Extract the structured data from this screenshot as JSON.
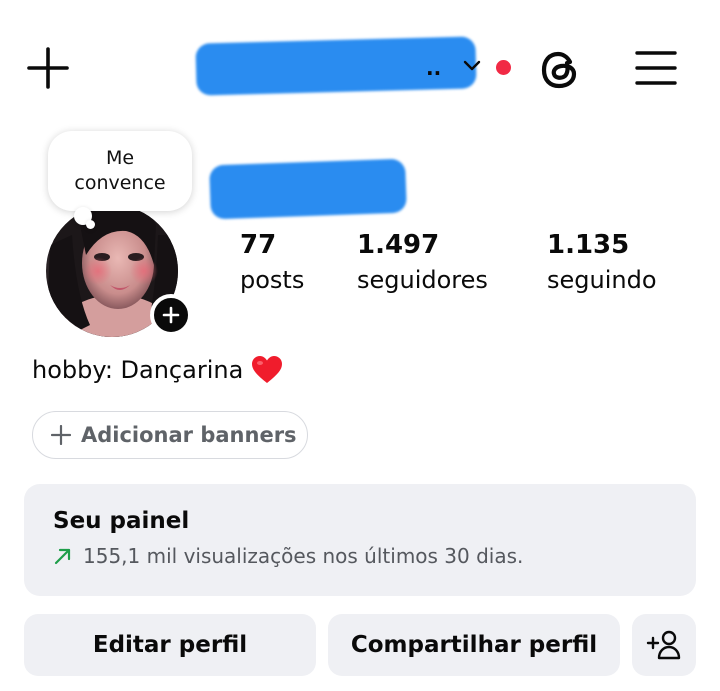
{
  "header": {
    "username": "",
    "username_suffix": "..",
    "has_notification": true,
    "colors": {
      "notification_dot": "#f12a45",
      "redaction": "#2a8cf0"
    },
    "icons": [
      "plus-icon",
      "chevron-down-icon",
      "threads-icon",
      "hamburger-menu-icon"
    ]
  },
  "note": {
    "text": "Me\nconvence"
  },
  "profile": {
    "display_name": "",
    "bio": "hobby: Dançarina",
    "bio_emoji": "red-heart-icon"
  },
  "stats": {
    "posts_value": "77",
    "posts_label": "posts",
    "followers_value": "1.497",
    "followers_label": "seguidores",
    "following_value": "1.135",
    "following_label": "seguindo"
  },
  "banners": {
    "label": "Adicionar banners"
  },
  "dashboard": {
    "title": "Seu painel",
    "subtitle": "155,1 mil visualizações nos últimos 30 dias.",
    "colors": {
      "trend": "#1e9e4a",
      "card_bg": "#eff0f4"
    }
  },
  "actions": {
    "edit_label": "Editar perfil",
    "share_label": "Compartilhar perfil",
    "add_user_icon": "add-user-icon"
  }
}
